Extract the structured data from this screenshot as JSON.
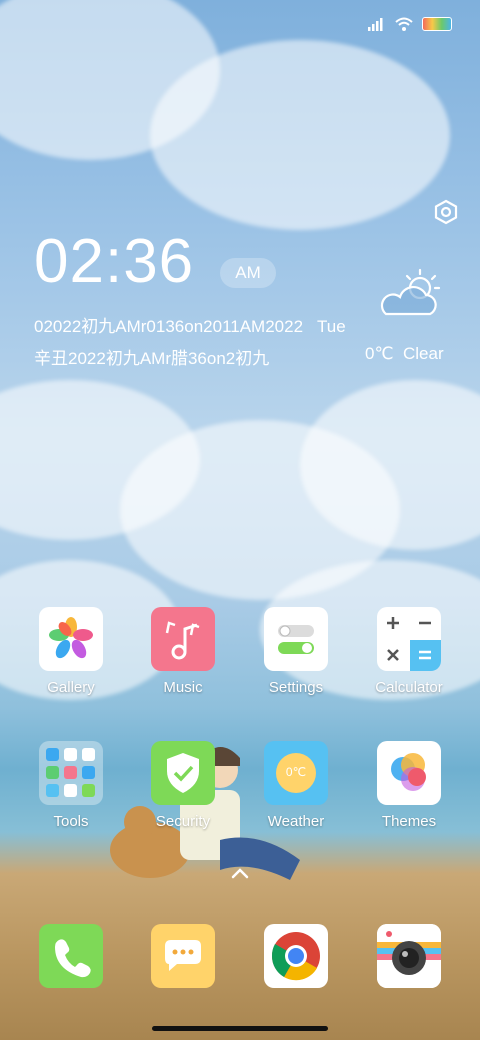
{
  "clock": {
    "time": "02:36",
    "ampm": "AM"
  },
  "date": {
    "line1": "02022初九AMr0136on2011AM2022",
    "day": "Tue",
    "line2": "辛丑2022初九AMr腊36on2初九"
  },
  "weather": {
    "temp": "0℃",
    "condition": "Clear"
  },
  "apps_row1": [
    {
      "label": "Gallery"
    },
    {
      "label": "Music"
    },
    {
      "label": "Settings"
    },
    {
      "label": "Calculator"
    }
  ],
  "apps_row2": [
    {
      "label": "Tools"
    },
    {
      "label": "Security"
    },
    {
      "label": "Weather",
      "tile_text": "0℃"
    },
    {
      "label": "Themes"
    }
  ],
  "dock": [
    "phone-icon",
    "messages-icon",
    "chrome-icon",
    "camera-icon"
  ],
  "colors": {
    "music": "#f4768d",
    "security": "#7ed957",
    "weather_tile": "#56c1f2",
    "phone": "#7ed957",
    "messages": "#ffd36a"
  }
}
